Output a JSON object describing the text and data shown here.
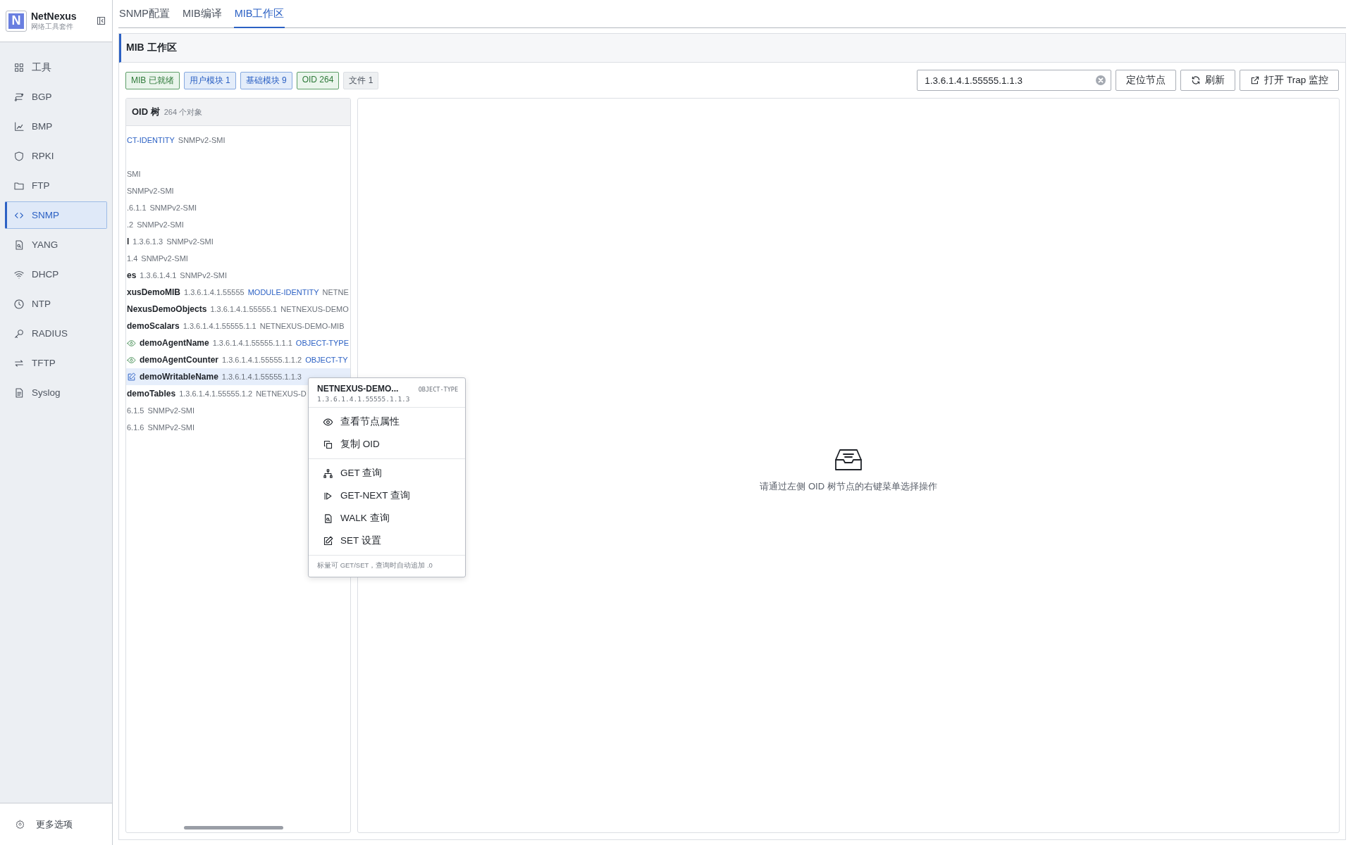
{
  "sidebar": {
    "brand": {
      "logo": "N",
      "name": "NetNexus",
      "subtitle": "网络工具套件"
    },
    "items": [
      {
        "label": "工具",
        "selected": false
      },
      {
        "label": "BGP",
        "selected": false
      },
      {
        "label": "BMP",
        "selected": false
      },
      {
        "label": "RPKI",
        "selected": false
      },
      {
        "label": "FTP",
        "selected": false
      },
      {
        "label": "SNMP",
        "selected": true
      },
      {
        "label": "YANG",
        "selected": false
      },
      {
        "label": "DHCP",
        "selected": false
      },
      {
        "label": "NTP",
        "selected": false
      },
      {
        "label": "RADIUS",
        "selected": false
      },
      {
        "label": "TFTP",
        "selected": false
      },
      {
        "label": "Syslog",
        "selected": false
      }
    ],
    "footer": {
      "label": "更多选项"
    }
  },
  "tabs": [
    {
      "label": "SNMP配置",
      "selected": false
    },
    {
      "label": "MIB编译",
      "selected": false
    },
    {
      "label": "MIB工作区",
      "selected": true
    }
  ],
  "panel": {
    "title": "MIB 工作区",
    "badges": [
      {
        "label": "MIB 已就绪",
        "kind": "success"
      },
      {
        "label": "用户模块 1",
        "kind": "info"
      },
      {
        "label": "基础模块 9",
        "kind": "info"
      },
      {
        "label": "OID 264",
        "kind": "success"
      },
      {
        "label": "文件 1",
        "kind": "neutral"
      }
    ],
    "search": {
      "value": "1.3.6.1.4.1.55555.1.1.3"
    },
    "buttons": [
      {
        "label": "定位节点"
      },
      {
        "label": "刷新"
      },
      {
        "label": "打开 Trap 监控"
      }
    ]
  },
  "tree": {
    "title": "OID 树",
    "count": "264 个对象",
    "rows": [
      {
        "type": "CT-IDENTITY",
        "module": "SNMPv2-SMI",
        "selected": false
      },
      {
        "module": "SMI",
        "selected": false
      },
      {
        "module": "SNMPv2-SMI",
        "selected": false
      },
      {
        "oid": ".6.1.1",
        "module": "SNMPv2-SMI",
        "selected": false
      },
      {
        "oid": ".2",
        "module": "SNMPv2-SMI",
        "selected": false
      },
      {
        "name": "l",
        "oid": "1.3.6.1.3",
        "module": "SNMPv2-SMI",
        "selected": false
      },
      {
        "oid": "1.4",
        "module": "SNMPv2-SMI",
        "selected": false
      },
      {
        "name": "es",
        "oid": "1.3.6.1.4.1",
        "module": "SNMPv2-SMI",
        "selected": false
      },
      {
        "name": "xusDemoMIB",
        "oid": "1.3.6.1.4.1.55555",
        "type": "MODULE-IDENTITY",
        "module": "NETNE",
        "selected": false
      },
      {
        "name": "NexusDemoObjects",
        "oid": "1.3.6.1.4.1.55555.1",
        "module": "NETNEXUS-DEMO",
        "selected": false
      },
      {
        "name": "demoScalars",
        "oid": "1.3.6.1.4.1.55555.1.1",
        "module": "NETNEXUS-DEMO-MIB",
        "selected": false
      },
      {
        "kind": "readable",
        "name": "demoAgentName",
        "oid": "1.3.6.1.4.1.55555.1.1.1",
        "type": "OBJECT-TYPE",
        "selected": false
      },
      {
        "kind": "readable",
        "name": "demoAgentCounter",
        "oid": "1.3.6.1.4.1.55555.1.1.2",
        "type": "OBJECT-TY",
        "selected": false
      },
      {
        "kind": "writable",
        "name": "demoWritableName",
        "oid": "1.3.6.1.4.1.55555.1.1.3",
        "selected": true
      },
      {
        "name": "demoTables",
        "oid": "1.3.6.1.4.1.55555.1.2",
        "module": "NETNEXUS-D",
        "selected": false
      },
      {
        "oid": "6.1.5",
        "module": "SNMPv2-SMI",
        "selected": false
      },
      {
        "oid": "6.1.6",
        "module": "SNMPv2-SMI",
        "selected": false
      }
    ]
  },
  "context_menu": {
    "title": "NETNEXUS-DEMO...",
    "type": "OBJECT-TYPE",
    "oid": "1.3.6.1.4.1.55555.1.1.3",
    "groups": [
      [
        {
          "label": "查看节点属性"
        },
        {
          "label": "复制 OID"
        }
      ],
      [
        {
          "label": "GET 查询"
        },
        {
          "label": "GET-NEXT 查询"
        },
        {
          "label": "WALK 查询"
        },
        {
          "label": "SET 设置"
        }
      ]
    ],
    "hint": "标量可 GET/SET，查询时自动追加 .0"
  },
  "empty_state": {
    "message": "请通过左侧 OID 树节点的右键菜单选择操作"
  }
}
